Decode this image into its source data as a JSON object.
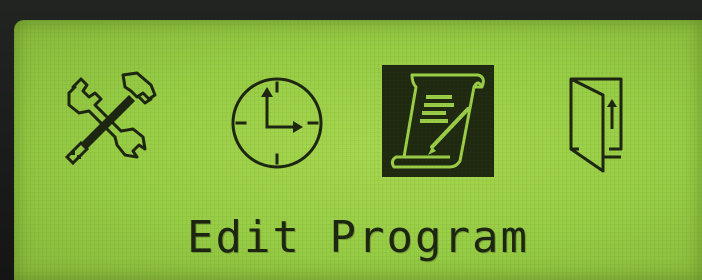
{
  "screen": {
    "caption": "Edit Program",
    "background_color": "#9ccf48",
    "ink_color": "#1d2411"
  },
  "menu": {
    "selected_index": 2,
    "items": [
      {
        "icon": "tools-icon",
        "selected": false
      },
      {
        "icon": "clock-icon",
        "selected": false
      },
      {
        "icon": "edit-document-icon",
        "selected": true
      },
      {
        "icon": "exit-door-icon",
        "selected": false
      }
    ]
  }
}
